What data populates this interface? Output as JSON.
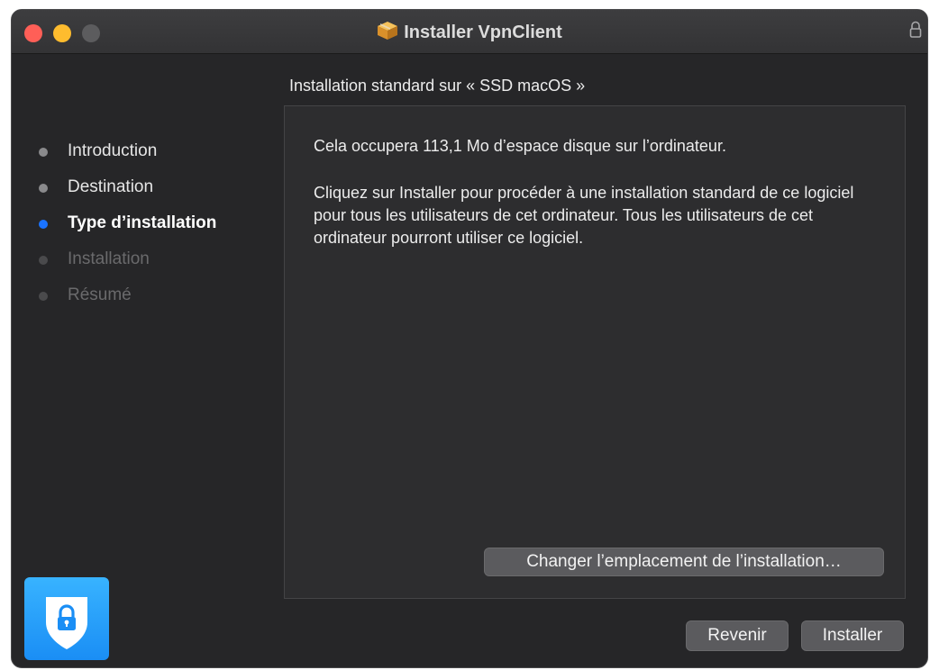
{
  "window": {
    "title": "Installer VpnClient"
  },
  "breadcrumb": "Installation standard sur « SSD macOS »",
  "sidebar": {
    "steps": [
      {
        "label": "Introduction",
        "state": "done"
      },
      {
        "label": "Destination",
        "state": "done"
      },
      {
        "label": "Type d’installation",
        "state": "active"
      },
      {
        "label": "Installation",
        "state": "pending"
      },
      {
        "label": "Résumé",
        "state": "pending"
      }
    ]
  },
  "content": {
    "space_text": "Cela occupera 113,1 Mo d’espace disque sur l’ordinateur.",
    "info_text": "Cliquez sur Installer pour procéder à une installation standard de ce logiciel pour tous les utilisateurs de cet ordinateur. Tous les utilisateurs de cet ordinateur pourront utiliser ce logiciel."
  },
  "buttons": {
    "change_location": "Changer l’emplacement de l’installation…",
    "back": "Revenir",
    "install": "Installer"
  },
  "colors": {
    "close": "#ff5f57",
    "minimize": "#febc2e",
    "active_step": "#1a73ff",
    "app_icon": "#1a8ef5"
  },
  "icons": {
    "title_icon": "package-icon",
    "title_lock": "lock-icon",
    "app_icon": "shield-lock-icon"
  }
}
